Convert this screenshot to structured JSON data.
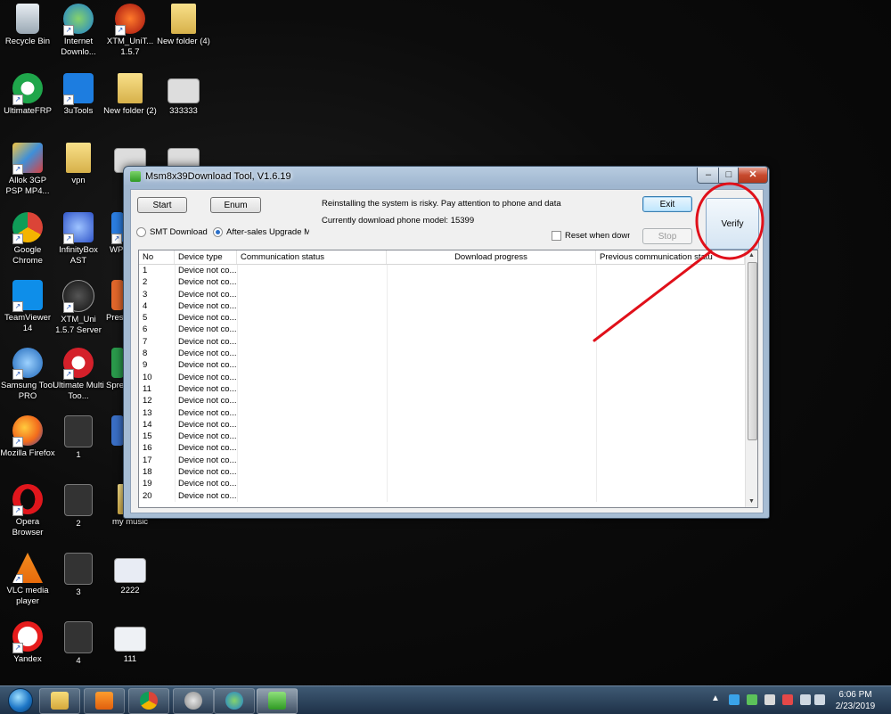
{
  "desktop": {
    "icons": [
      {
        "label": "Recycle Bin"
      },
      {
        "label": "Internet Downlo..."
      },
      {
        "label": "XTM_UniT... 1.5.7"
      },
      {
        "label": "New folder (4)"
      },
      {
        "label": "UltimateFRP"
      },
      {
        "label": "3uTools"
      },
      {
        "label": "New folder (2)"
      },
      {
        "label": "333333"
      },
      {
        "label": "Allok 3GP PSP MP4..."
      },
      {
        "label": "vpn"
      },
      {
        "label": "Google Chrome"
      },
      {
        "label": "InfinityBox AST"
      },
      {
        "label": "WP"
      },
      {
        "label": "TeamViewer 14"
      },
      {
        "label": "XTM_Uni 1.5.7 Server"
      },
      {
        "label": "Pres"
      },
      {
        "label": "Samsung Tool PRO"
      },
      {
        "label": "Ultimate Multi Too..."
      },
      {
        "label": "Spre"
      },
      {
        "label": "Mozilla Firefox"
      },
      {
        "label": "1"
      },
      {
        "label": "Opera Browser"
      },
      {
        "label": "2"
      },
      {
        "label": "my music"
      },
      {
        "label": "VLC media player"
      },
      {
        "label": "3"
      },
      {
        "label": "2222"
      },
      {
        "label": "Yandex"
      },
      {
        "label": "4"
      },
      {
        "label": "111"
      }
    ]
  },
  "window": {
    "title": "Msm8x39Download Tool, V1.6.19",
    "caption": {
      "minimize": "–",
      "maximize": "□",
      "close": "✕"
    },
    "start_label": "Start",
    "enum_label": "Enum",
    "warning_text": "Reinstalling the system is risky. Pay attention to phone and data",
    "model_text": "Currently download phone model: 15399",
    "exit_label": "Exit",
    "stop_label": "Stop",
    "verify_label": "Verify",
    "radio_smt": "SMT Download Mo",
    "radio_aftersales": "After-sales Upgrade Moc",
    "reset_checkbox": "Reset when downlc",
    "columns": [
      "No",
      "Device type",
      "Communication status",
      "Download progress",
      "Previous communication statu"
    ],
    "rows": [
      {
        "no": "1",
        "device": "Device not co..."
      },
      {
        "no": "2",
        "device": "Device not co..."
      },
      {
        "no": "3",
        "device": "Device not co..."
      },
      {
        "no": "4",
        "device": "Device not co..."
      },
      {
        "no": "5",
        "device": "Device not co..."
      },
      {
        "no": "6",
        "device": "Device not co..."
      },
      {
        "no": "7",
        "device": "Device not co..."
      },
      {
        "no": "8",
        "device": "Device not co..."
      },
      {
        "no": "9",
        "device": "Device not co..."
      },
      {
        "no": "10",
        "device": "Device not co..."
      },
      {
        "no": "11",
        "device": "Device not co..."
      },
      {
        "no": "12",
        "device": "Device not co..."
      },
      {
        "no": "13",
        "device": "Device not co..."
      },
      {
        "no": "14",
        "device": "Device not co..."
      },
      {
        "no": "15",
        "device": "Device not co..."
      },
      {
        "no": "16",
        "device": "Device not co..."
      },
      {
        "no": "17",
        "device": "Device not co..."
      },
      {
        "no": "18",
        "device": "Device not co..."
      },
      {
        "no": "19",
        "device": "Device not co..."
      },
      {
        "no": "20",
        "device": "Device not co..."
      }
    ],
    "scroll_up": "▲",
    "scroll_down": "▼"
  },
  "annotation": {
    "color": "#e0101a"
  },
  "taskbar": {
    "time": "6:06 PM",
    "date": "2/23/2019",
    "tray_expand": "▲"
  }
}
